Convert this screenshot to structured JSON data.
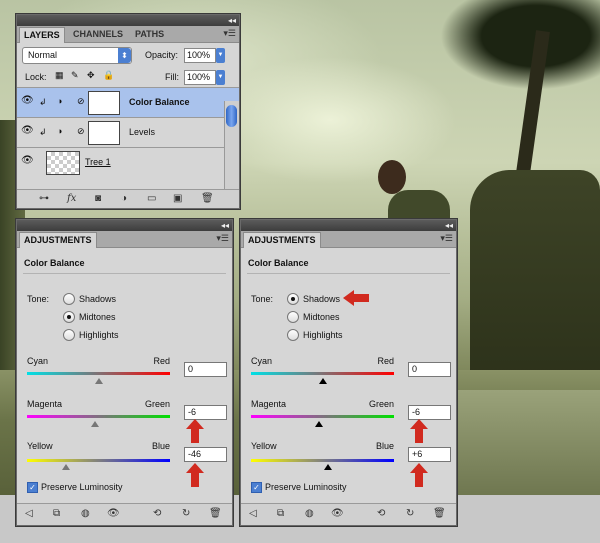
{
  "layers_panel": {
    "tabs": [
      "LAYERS",
      "CHANNELS",
      "PATHS"
    ],
    "blend_mode": "Normal",
    "opacity_label": "Opacity:",
    "opacity_value": "100%",
    "lock_label": "Lock:",
    "fill_label": "Fill:",
    "fill_value": "100%",
    "layers": [
      {
        "name": "Color Balance",
        "selected": true
      },
      {
        "name": "Levels",
        "selected": false
      },
      {
        "name": "Tree 1",
        "selected": false
      }
    ]
  },
  "adjustments_left": {
    "tab": "ADJUSTMENTS",
    "title": "Color Balance",
    "tone_label": "Tone:",
    "tones": [
      "Shadows",
      "Midtones",
      "Highlights"
    ],
    "selected_tone": "Midtones",
    "sliders": [
      {
        "left": "Cyan",
        "right": "Red",
        "value": "0"
      },
      {
        "left": "Magenta",
        "right": "Green",
        "value": "-6"
      },
      {
        "left": "Yellow",
        "right": "Blue",
        "value": "-46"
      }
    ],
    "preserve_label": "Preserve Luminosity",
    "preserve_checked": true
  },
  "adjustments_right": {
    "tab": "ADJUSTMENTS",
    "title": "Color Balance",
    "tone_label": "Tone:",
    "tones": [
      "Shadows",
      "Midtones",
      "Highlights"
    ],
    "selected_tone": "Shadows",
    "sliders": [
      {
        "left": "Cyan",
        "right": "Red",
        "value": "0"
      },
      {
        "left": "Magenta",
        "right": "Green",
        "value": "-6"
      },
      {
        "left": "Yellow",
        "right": "Blue",
        "value": "+6"
      }
    ],
    "preserve_label": "Preserve Luminosity",
    "preserve_checked": true
  },
  "colors": {
    "annotation_arrow": "#d12a1f",
    "selection": "#a9c2ec",
    "panel": "#d6d6d6"
  }
}
